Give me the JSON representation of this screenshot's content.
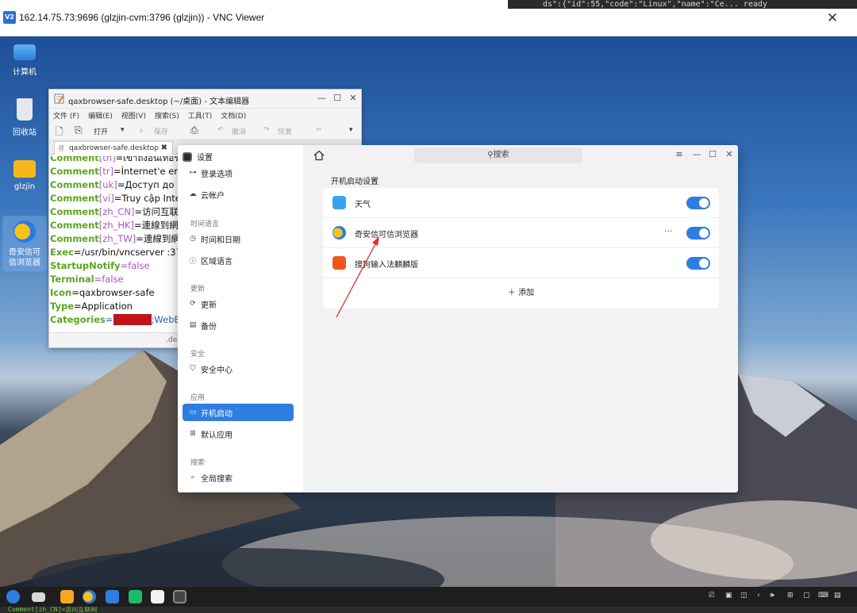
{
  "vnc": {
    "title": "162.14.75.73:9696 (glzjin-cvm:3796 (glzjin)) - VNC Viewer",
    "bg_text": "ds\":{\"id\":55,\"code\":\"Linux\",\"name\":\"Ce...  ready",
    "close": "✕",
    "logo": "V2"
  },
  "desktop": {
    "icons": [
      {
        "label": "计算机"
      },
      {
        "label": "回收站"
      },
      {
        "label": "glzjin"
      },
      {
        "label": "奇安信可信浏览器"
      }
    ]
  },
  "editor": {
    "title": "qaxbrowser-safe.desktop (~/桌面) - 文本编辑器",
    "menu": [
      "文件 (F)",
      "编辑(E)",
      "视图(V)",
      "搜索(S)",
      "工具(T)",
      "文档(D)"
    ],
    "toolbar": {
      "open": "打开",
      "save": "保存",
      "undo": "撤消",
      "redo": "恢复"
    },
    "tab": "qaxbrowser-safe.desktop",
    "lines": [
      {
        "key": "Comment",
        "loc": "[th]",
        "val": "=เข้าถึงอินเทอร์เน็ต"
      },
      {
        "key": "Comment",
        "loc": "[tr]",
        "val": "=İnternet'e erişin"
      },
      {
        "key": "Comment",
        "loc": "[uk]",
        "val": "=Доступ до Інте"
      },
      {
        "key": "Comment",
        "loc": "[vi]",
        "val": "=Truy cập Interne"
      },
      {
        "key": "Comment",
        "loc": "[zh_CN]",
        "val": "=访问互联网"
      },
      {
        "key": "Comment",
        "loc": "[zh_HK]",
        "val": "=連線到網際"
      },
      {
        "key": "Comment",
        "loc": "[zh_TW]",
        "val": "=連線到網際"
      },
      {
        "key": "Exec",
        "loc": "",
        "val": "=/usr/bin/vncserver :3796"
      },
      {
        "key": "StartupNotify",
        "loc": "",
        "val": "=false"
      },
      {
        "key": "Terminal",
        "loc": "",
        "val": "=false"
      },
      {
        "key": "Icon",
        "loc": "",
        "val": "=qaxbrowser-safe"
      },
      {
        "key": "Type",
        "loc": "",
        "val": "=Application"
      },
      {
        "key": "Categories",
        "loc": "",
        "val": "=Network;WebBrow"
      }
    ],
    "status": ".des"
  },
  "settings": {
    "app_title": "设置",
    "search_placeholder": "搜索",
    "sidebar": [
      {
        "label": "登录选项",
        "icon": "⊶"
      },
      {
        "label": "云帐户",
        "icon": "☁"
      },
      {
        "group": "时间语言"
      },
      {
        "label": "时间和日期",
        "icon": "◷"
      },
      {
        "label": "区域语言",
        "icon": "ⓘ"
      },
      {
        "group": "更新"
      },
      {
        "label": "更新",
        "icon": "⟳"
      },
      {
        "label": "备份",
        "icon": "▤"
      },
      {
        "group": "安全"
      },
      {
        "label": "安全中心",
        "icon": "⛉"
      },
      {
        "group": "应用"
      },
      {
        "label": "开机启动",
        "icon": "▭",
        "active": true
      },
      {
        "label": "默认应用",
        "icon": "⊞"
      },
      {
        "group": "搜索"
      },
      {
        "label": "全局搜索",
        "icon": "⌕"
      }
    ],
    "section_title": "开机启动设置",
    "startup_apps": [
      {
        "name": "天气",
        "enabled": true,
        "color": "#37a3f0"
      },
      {
        "name": "奇安信可信浏览器",
        "enabled": true,
        "color": "#f5c21b",
        "more": "···"
      },
      {
        "name": "搜狗输入法麒麟版",
        "enabled": true,
        "color": "#f2551c"
      }
    ],
    "add_label": "＋  添加"
  },
  "taskbar": {
    "bottom_text": "Comment[zh_CN]=访问互联网"
  },
  "colors": {
    "accent": "#2f7de1",
    "arrow": "#e0302a"
  }
}
